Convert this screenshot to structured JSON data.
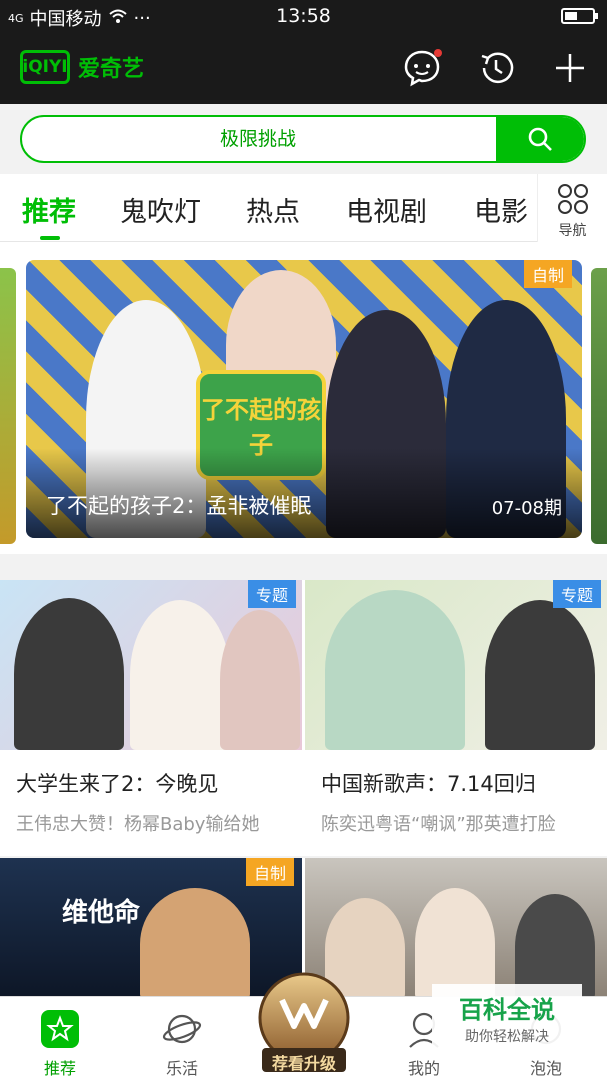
{
  "status_bar": {
    "signal": "4G",
    "carrier": "中国移动",
    "time": "13:58",
    "more": "···"
  },
  "app": {
    "logo_text": "iQIYI",
    "name": "爱奇艺"
  },
  "search": {
    "term": "极限挑战"
  },
  "tabs": [
    {
      "label": "推荐",
      "active": true
    },
    {
      "label": "鬼吹灯"
    },
    {
      "label": "热点"
    },
    {
      "label": "电视剧"
    },
    {
      "label": "电影"
    }
  ],
  "nav_button": {
    "label": "导航"
  },
  "hero": {
    "badge": "自制",
    "title": "了不起的孩子2：孟非被催眠",
    "episode": "07-08期",
    "logo_text": "了不起的孩子"
  },
  "cards": [
    {
      "badge": "专题",
      "title": "大学生来了2：今晚见",
      "subtitle": "王伟忠大赞！杨幂Baby输给她"
    },
    {
      "badge": "专题",
      "title": "中国新歌声：7.14回归",
      "subtitle": "陈奕迅粤语“嘲讽”那英遭打脸"
    }
  ],
  "row3": {
    "badge": "自制",
    "left_caption": "维他命"
  },
  "bottom_nav": [
    {
      "label": "推荐",
      "icon": "star-icon",
      "active": true
    },
    {
      "label": "乐活",
      "icon": "planet-icon"
    },
    {
      "label": "我的",
      "icon": "user-icon"
    },
    {
      "label": "泡泡",
      "icon": "bubble-icon"
    }
  ],
  "upgrade": {
    "label": "荐看升级"
  },
  "watermark": {
    "title": "百科全说",
    "subtitle": "助你轻松解决"
  },
  "colors": {
    "brand_green": "#00be06",
    "badge_orange": "#f5a623",
    "badge_blue": "#3a8ee6"
  }
}
